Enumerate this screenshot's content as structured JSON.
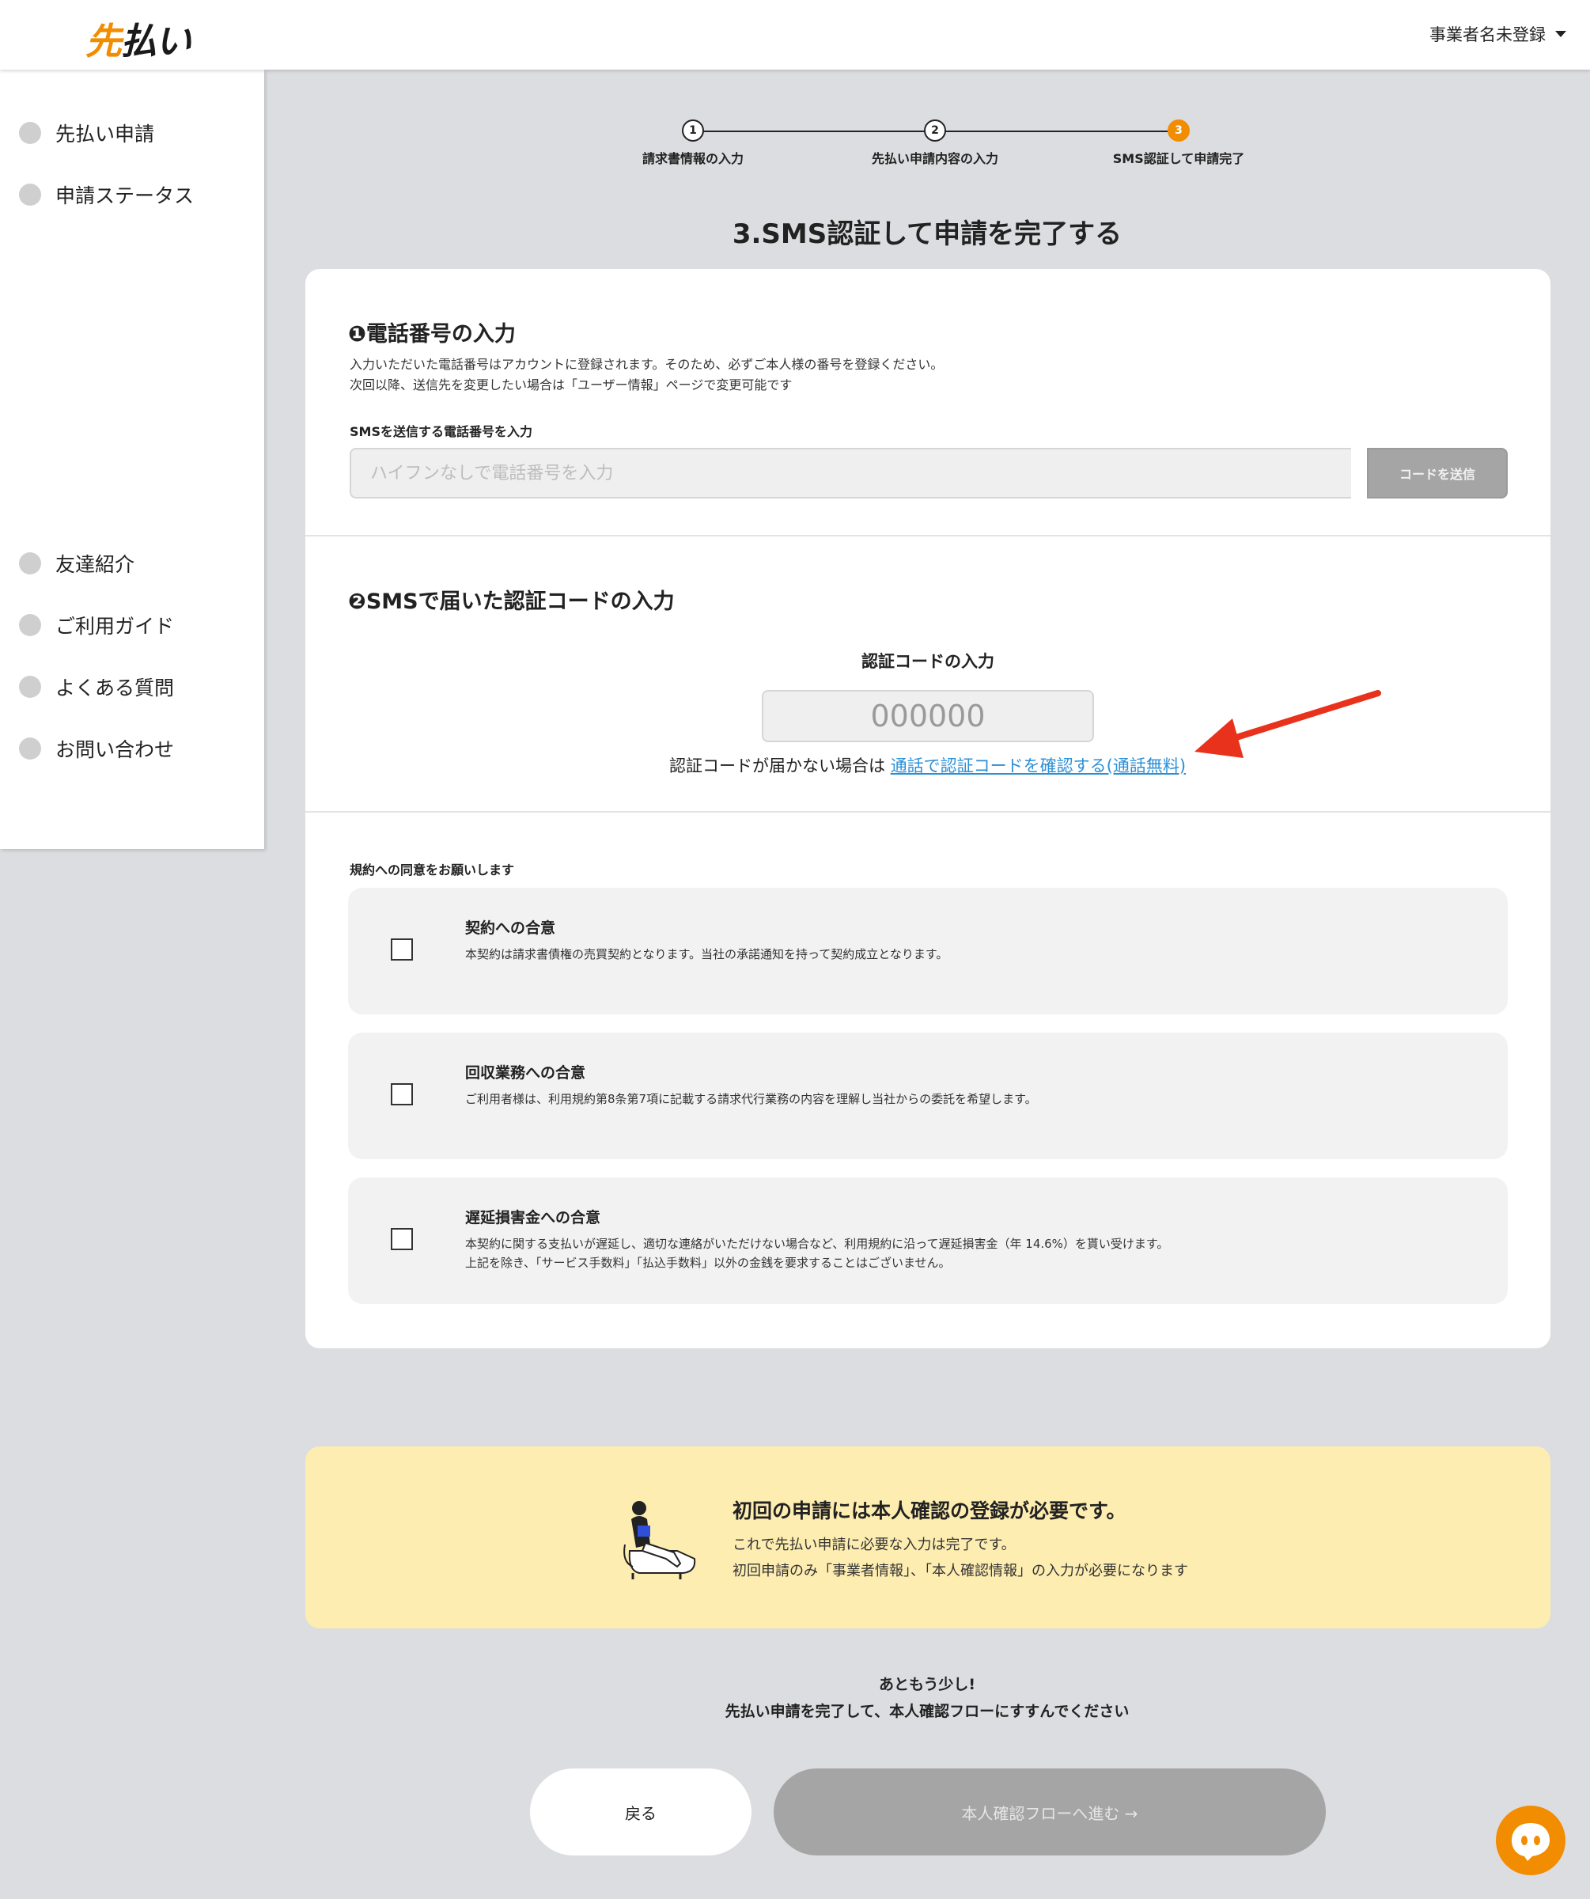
{
  "header": {
    "logo_accent": "先",
    "logo_rest": "払い",
    "user_menu_label": "事業者名未登録"
  },
  "sidebar": {
    "items": [
      {
        "label": "先払い申請"
      },
      {
        "label": "申請ステータス"
      },
      {
        "label": "友達紹介"
      },
      {
        "label": "ご利用ガイド"
      },
      {
        "label": "よくある質問"
      },
      {
        "label": "お問い合わせ"
      }
    ]
  },
  "stepper": {
    "steps": [
      {
        "num": "1",
        "label": "請求書情報の入力"
      },
      {
        "num": "2",
        "label": "先払い申請内容の入力"
      },
      {
        "num": "3",
        "label": "SMS認証して申請完了"
      }
    ],
    "current_step": 3
  },
  "page_title": "3.SMS認証して申請を完了する",
  "phone_section": {
    "title": "❶電話番号の入力",
    "note_line1": "入力いただいた電話番号はアカウントに登録されます。そのため、必ずご本人様の番号を登録ください。",
    "note_line2": "次回以降、送信先を変更したい場合は「ユーザー情報」ページで変更可能です",
    "field_label": "SMSを送信する電話番号を入力",
    "input_placeholder": "ハイフンなしで電話番号を入力",
    "input_value": "",
    "send_button": "コードを送信"
  },
  "code_section": {
    "title": "❷SMSで届いた認証コードの入力",
    "code_label": "認証コードの入力",
    "code_placeholder": "000000",
    "code_value": "",
    "resend_prefix": "認証コードが届かない場合は",
    "resend_link": "通話で認証コードを確認する(通話無料)"
  },
  "terms": {
    "heading": "規約への同意をお願いします",
    "items": [
      {
        "title": "契約への合意",
        "text_line1": "本契約は請求書債権の売買契約となります。当社の承諾通知を持って契約成立となります。",
        "text_line2": "",
        "checked": false
      },
      {
        "title": "回収業務への合意",
        "text_line1": "ご利用者様は、利用規約第8条第7項に記載する請求代行業務の内容を理解し当社からの委託を希望します。",
        "text_line2": "",
        "checked": false
      },
      {
        "title": "遅延損害金への合意",
        "text_line1": "本契約に関する支払いが遅延し、適切な連絡がいただけない場合など、利用規約に沿って遅延損害金（年 14.6%）を貰い受けます。",
        "text_line2": "上記を除き、「サービス手数料」「払込手数料」以外の金銭を要求することはございません。",
        "checked": false
      }
    ]
  },
  "notice": {
    "title": "初回の申請には本人確認の登録が必要です。",
    "line1": "これで先払い申請に必要な入力は完了です。",
    "line2": "初回申請のみ「事業者情報」、「本人確認情報」の入力が必要になります"
  },
  "encourage": {
    "line1": "あともう少し!",
    "line2": "先払い申請を完了して、本人確認フローにすすんでください"
  },
  "buttons": {
    "back": "戻る",
    "next": "本人確認フローへ進む →"
  },
  "colors": {
    "accent": "#f28c00",
    "link": "#2c8fd6",
    "disabled": "#a5a5a5",
    "notice_bg": "#fdedb0",
    "annotation_arrow": "#e8321c"
  },
  "icons": {
    "chat": "chat-bubble-icon",
    "checkbox": "checkbox-icon",
    "caret": "caret-down-icon",
    "arrow": "red-arrow-annotation"
  }
}
